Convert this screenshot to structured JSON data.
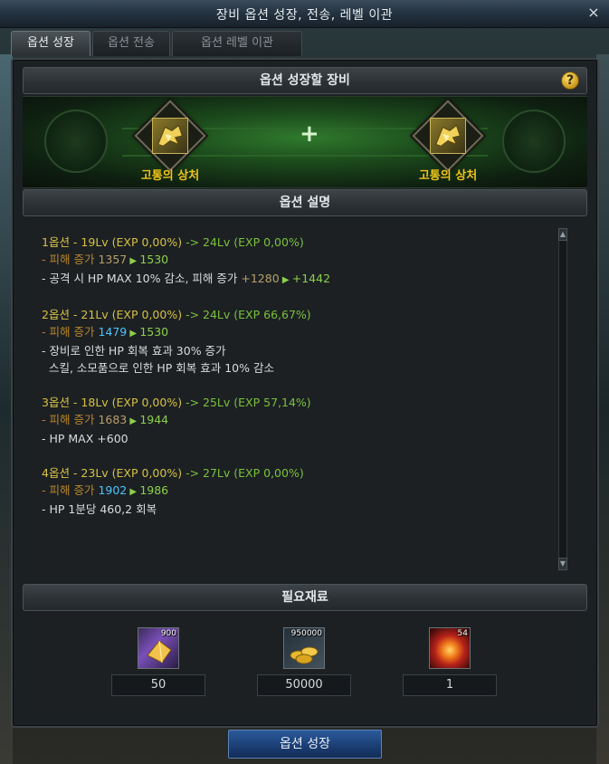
{
  "window": {
    "title": "장비 옵션 성장, 전송, 레벨 이관",
    "close_label": "×"
  },
  "tabs": [
    {
      "label": "옵션 성장",
      "active": true
    },
    {
      "label": "옵션 전송",
      "active": false
    },
    {
      "label": "옵션 레벨 이관",
      "active": false
    }
  ],
  "equip_section": {
    "header": "옵션 성장할 장비",
    "help_label": "?",
    "left_item": {
      "name": "고통의 상처",
      "icon": "wing-emblem-icon"
    },
    "right_item": {
      "name": "고통의 상처",
      "icon": "wing-emblem-icon"
    },
    "plus": "+"
  },
  "desc_section": {
    "header": "옵션 설명",
    "options": [
      {
        "head": "1옵션 - 19Lv (EXP 0,00%)",
        "arrow": " -> 24Lv (EXP 0,00%)",
        "lines": [
          {
            "prefix": "- 피해 증가 ",
            "from": "1357",
            "to": "1530",
            "from_color": "base"
          },
          {
            "prefix": "- 공격 시 HP MAX 10% 감소, 피해 증가 ",
            "from": "+1280",
            "to": "+1442",
            "from_color": "base",
            "prefix_color": "white"
          }
        ]
      },
      {
        "head": "2옵션 - 21Lv (EXP 0,00%)",
        "arrow": " -> 24Lv (EXP 66,67%)",
        "lines": [
          {
            "prefix": "- 피해 증가 ",
            "from": "1479",
            "to": "1530",
            "from_color": "blue"
          },
          {
            "text": "- 장비로 인한 HP 회복 효과 30% 증가"
          },
          {
            "text": "  스킬, 소모품으로 인한 HP 회복 효과 10% 감소"
          }
        ]
      },
      {
        "head": "3옵션 - 18Lv (EXP 0,00%)",
        "arrow": " -> 25Lv (EXP 57,14%)",
        "lines": [
          {
            "prefix": "- 피해 증가 ",
            "from": "1683",
            "to": "1944",
            "from_color": "base"
          },
          {
            "text": "- HP MAX +600"
          }
        ]
      },
      {
        "head": "4옵션 - 23Lv (EXP 0,00%)",
        "arrow": " -> 27Lv (EXP 0,00%)",
        "lines": [
          {
            "prefix": "- 피해 증가 ",
            "from": "1902",
            "to": "1986",
            "from_color": "blue"
          },
          {
            "text": "- HP 1분당 460,2 회복"
          }
        ]
      }
    ]
  },
  "materials_section": {
    "header": "필요재료",
    "items": [
      {
        "icon": "purple-crystal-icon",
        "stock": "900",
        "required": "50"
      },
      {
        "icon": "gold-coins-icon",
        "stock": "950000",
        "required": "50000"
      },
      {
        "icon": "fire-burst-icon",
        "stock": "54",
        "required": "1"
      }
    ]
  },
  "action": {
    "grow_label": "옵션 성장"
  },
  "colors": {
    "level_text": "#d6c145",
    "arrow_text": "#7ac13c",
    "sub_text": "#b8862d",
    "blue_value": "#4ec3ff",
    "item_name": "#f0c419",
    "button_blue": "#1c3f75"
  }
}
